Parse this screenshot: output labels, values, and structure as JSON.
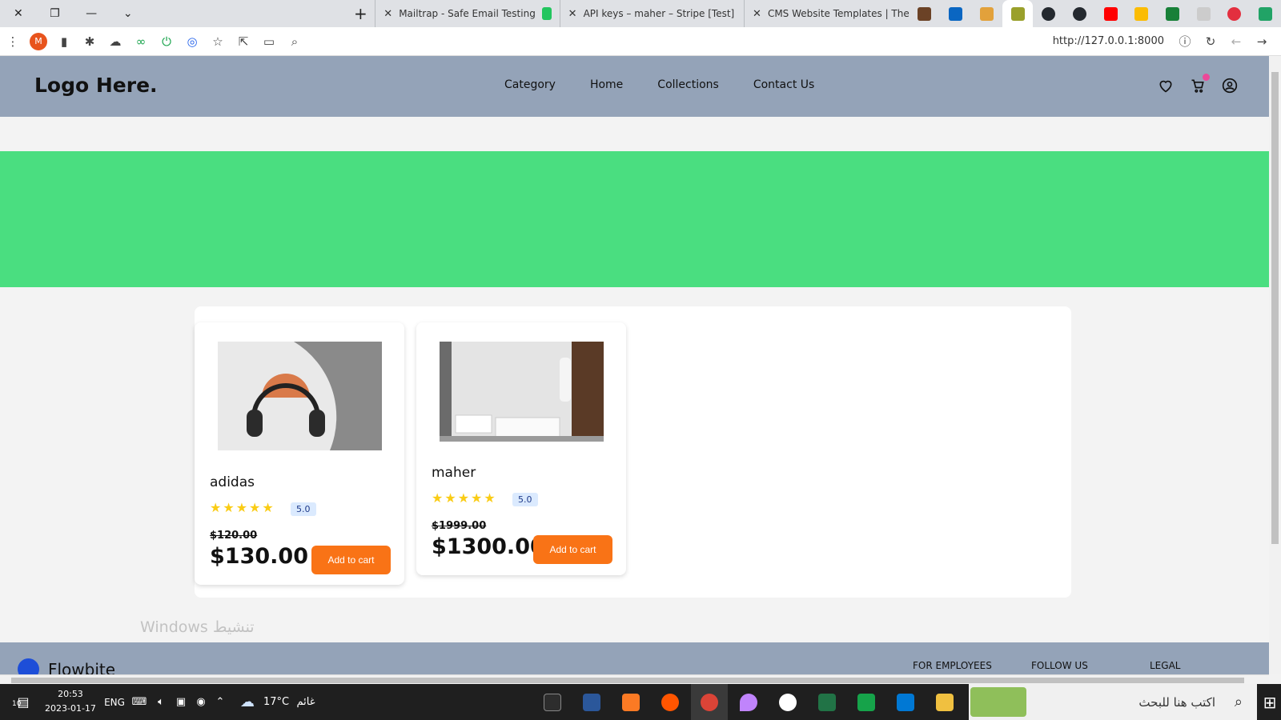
{
  "browser": {
    "tabs": [
      {
        "label": "Mailtrap - Safe Email Testing",
        "favicon_color": "#22c55e"
      },
      {
        "label": "API keys – maher – Stripe [Test]",
        "favicon_color": "#635bff"
      },
      {
        "label": "CMS Website Templates | Theme",
        "favicon_color": "#6b4226"
      }
    ],
    "pinned_tab_colors": [
      "#0a66c2",
      "#e2a13b",
      "#9aa02b",
      "#24292f",
      "#24292f",
      "#ff0000",
      "#fbbc04",
      "#188038",
      "#aaaaaa",
      "#e32f3f",
      "#21a366"
    ],
    "url": "http://127.0.0.1:8000",
    "profile_initial": "M"
  },
  "site": {
    "logo": "Logo Here.",
    "nav": [
      "Category",
      "Home",
      "Collections",
      "Contact Us"
    ],
    "products": [
      {
        "name": "adidas",
        "rating": "5.0",
        "stars": 5,
        "old_price": "$120.00",
        "price": "$130.00",
        "button": "Add to cart",
        "image": "headphones"
      },
      {
        "name": "maher",
        "rating": "5.0",
        "stars": 5,
        "old_price": "$1999.00",
        "price": "$1300.00",
        "button": "Add to cart",
        "image": "bathroom"
      }
    ],
    "watermark": "Windows تنشيط",
    "footer": {
      "brand": "Flowbite",
      "columns": [
        "FOR EMPLOYEES",
        "FOLLOW US",
        "LEGAL"
      ]
    },
    "colors": {
      "header": "#94a3b8",
      "hero": "#4ade80",
      "accent": "#f97316",
      "dot": "#ec4899"
    }
  },
  "taskbar": {
    "time": "20:53",
    "date": "2023-01-17",
    "language": "ENG",
    "weather_temp": "17°C",
    "weather_desc": "غائم",
    "search_placeholder": "اكتب هنا للبحث",
    "notification_count": "10"
  }
}
